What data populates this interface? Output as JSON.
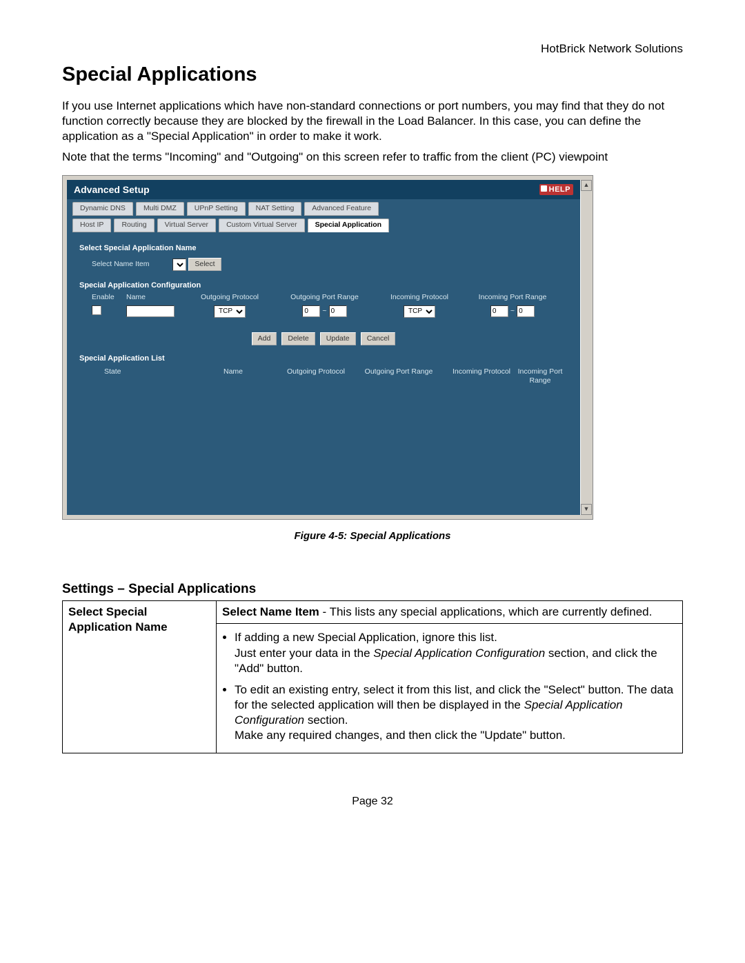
{
  "header_brand": "HotBrick Network Solutions",
  "title": "Special Applications",
  "para1": "If you use Internet applications which have non-standard connections or port numbers, you may find that they do not function correctly because they are blocked by the firewall in the Load Balancer. In this case, you can define the application as a \"Special Application\" in order to make it work.",
  "para2": "Note that the terms \"Incoming\" and \"Outgoing\" on this screen refer to traffic from the client (PC) viewpoint",
  "figure_caption": "Figure 4-5: Special Applications",
  "subtitle": "Settings – Special Applications",
  "page_number": "Page 32",
  "router": {
    "panel_title": "Advanced Setup",
    "help_label": "HELP",
    "tabs_row1": [
      "Dynamic DNS",
      "Multi DMZ",
      "UPnP Setting",
      "NAT Setting",
      "Advanced Feature"
    ],
    "tabs_row2": [
      "Host IP",
      "Routing",
      "Virtual Server",
      "Custom Virtual Server",
      "Special Application"
    ],
    "select_section": "Select Special Application Name",
    "select_label": "Select Name Item",
    "select_button": "Select",
    "config_section": "Special Application Configuration",
    "col_enable": "Enable",
    "col_name": "Name",
    "col_outproto": "Outgoing Protocol",
    "col_outrange": "Outgoing Port Range",
    "col_inproto": "Incoming Protocol",
    "col_inrange": "Incoming Port Range",
    "proto_value": "TCP",
    "port_default": "0",
    "btn_add": "Add",
    "btn_delete": "Delete",
    "btn_update": "Update",
    "btn_cancel": "Cancel",
    "list_section": "Special Application List",
    "list_state": "State",
    "list_name": "Name",
    "list_outproto": "Outgoing Protocol",
    "list_outrange": "Outgoing Port Range",
    "list_inproto": "Incoming Protocol",
    "list_inrange": "Incoming Port Range"
  },
  "table": {
    "row1_label": "Select Special Application Name",
    "row1_text_lead": "Select Name Item",
    "row1_text_a": " - This lists any special applications, which are currently defined.",
    "bullet1_a": "If adding a new Special Application, ignore this list.",
    "bullet1_b": "Just enter your data in the ",
    "bullet1_italic": "Special Application Configuration",
    "bullet1_c": " section, and click the \"Add\" button.",
    "bullet2_a": "To edit an existing entry, select it from this list, and click the \"Select\" button. The data for the selected application will then be displayed in the ",
    "bullet2_italic": "Special Application Configuration",
    "bullet2_b": " section.",
    "bullet2_c": "Make any required changes, and then click the \"Update\" button."
  }
}
